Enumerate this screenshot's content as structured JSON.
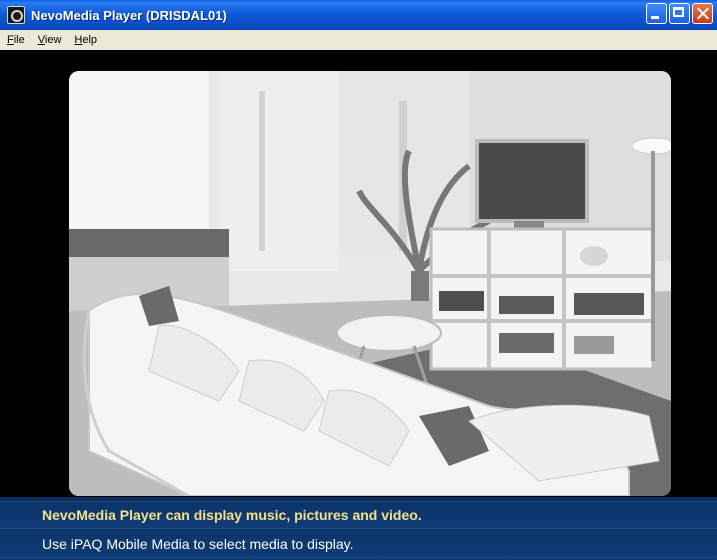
{
  "window": {
    "title": "NevoMedia Player (DRISDAL01)",
    "icon": "app-icon"
  },
  "menu": {
    "items": [
      {
        "accel": "F",
        "rest": "ile"
      },
      {
        "accel": "V",
        "rest": "iew"
      },
      {
        "accel": "H",
        "rest": "elp"
      }
    ]
  },
  "status": {
    "line1": "NevoMedia Player can display music, pictures and video.",
    "line2": "Use iPAQ Mobile Media to select media to display."
  },
  "colors": {
    "titlebar": "#0a4fc8",
    "status_highlight": "#f4e08a",
    "status_bg": "#0e3a74"
  }
}
